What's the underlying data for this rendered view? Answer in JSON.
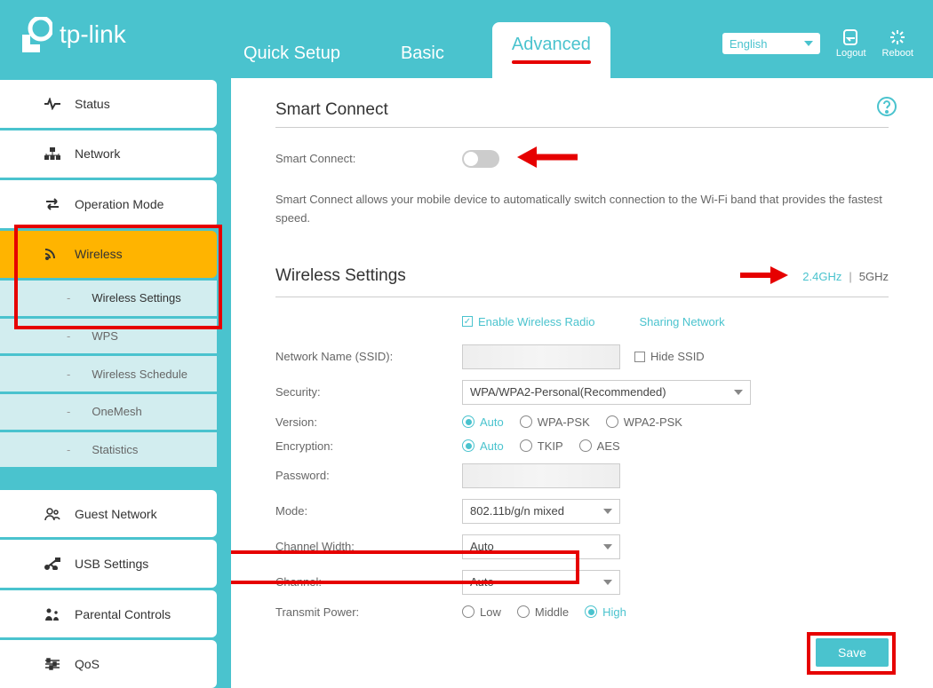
{
  "brand": "tp-link",
  "tabs": {
    "quick_setup": "Quick Setup",
    "basic": "Basic",
    "advanced": "Advanced"
  },
  "language": "English",
  "logout_label": "Logout",
  "reboot_label": "Reboot",
  "sidebar": {
    "status": "Status",
    "network": "Network",
    "operation_mode": "Operation Mode",
    "wireless": "Wireless",
    "wireless_subs": {
      "settings": "Wireless Settings",
      "wps": "WPS",
      "schedule": "Wireless Schedule",
      "onemesh": "OneMesh",
      "statistics": "Statistics"
    },
    "guest_network": "Guest Network",
    "usb_settings": "USB Settings",
    "parental_controls": "Parental Controls",
    "qos": "QoS"
  },
  "smart_connect": {
    "title": "Smart Connect",
    "label": "Smart Connect:",
    "desc": "Smart Connect allows your mobile device to automatically switch connection to the Wi-Fi band that provides the fastest speed."
  },
  "wireless_settings": {
    "title": "Wireless Settings",
    "band24": "2.4GHz",
    "band5": "5GHz",
    "enable_radio": "Enable Wireless Radio",
    "sharing_network": "Sharing Network",
    "ssid_label": "Network Name (SSID):",
    "ssid_value": "",
    "hide_ssid": "Hide SSID",
    "security_label": "Security:",
    "security_value": "WPA/WPA2-Personal(Recommended)",
    "version_label": "Version:",
    "version_options": {
      "auto": "Auto",
      "wpa_psk": "WPA-PSK",
      "wpa2_psk": "WPA2-PSK"
    },
    "encryption_label": "Encryption:",
    "encryption_options": {
      "auto": "Auto",
      "tkip": "TKIP",
      "aes": "AES"
    },
    "password_label": "Password:",
    "mode_label": "Mode:",
    "mode_value": "802.11b/g/n mixed",
    "channel_width_label": "Channel Width:",
    "channel_width_value": "Auto",
    "channel_label": "Channel:",
    "channel_value": "Auto",
    "transmit_power_label": "Transmit Power:",
    "transmit_options": {
      "low": "Low",
      "middle": "Middle",
      "high": "High"
    },
    "save": "Save"
  }
}
